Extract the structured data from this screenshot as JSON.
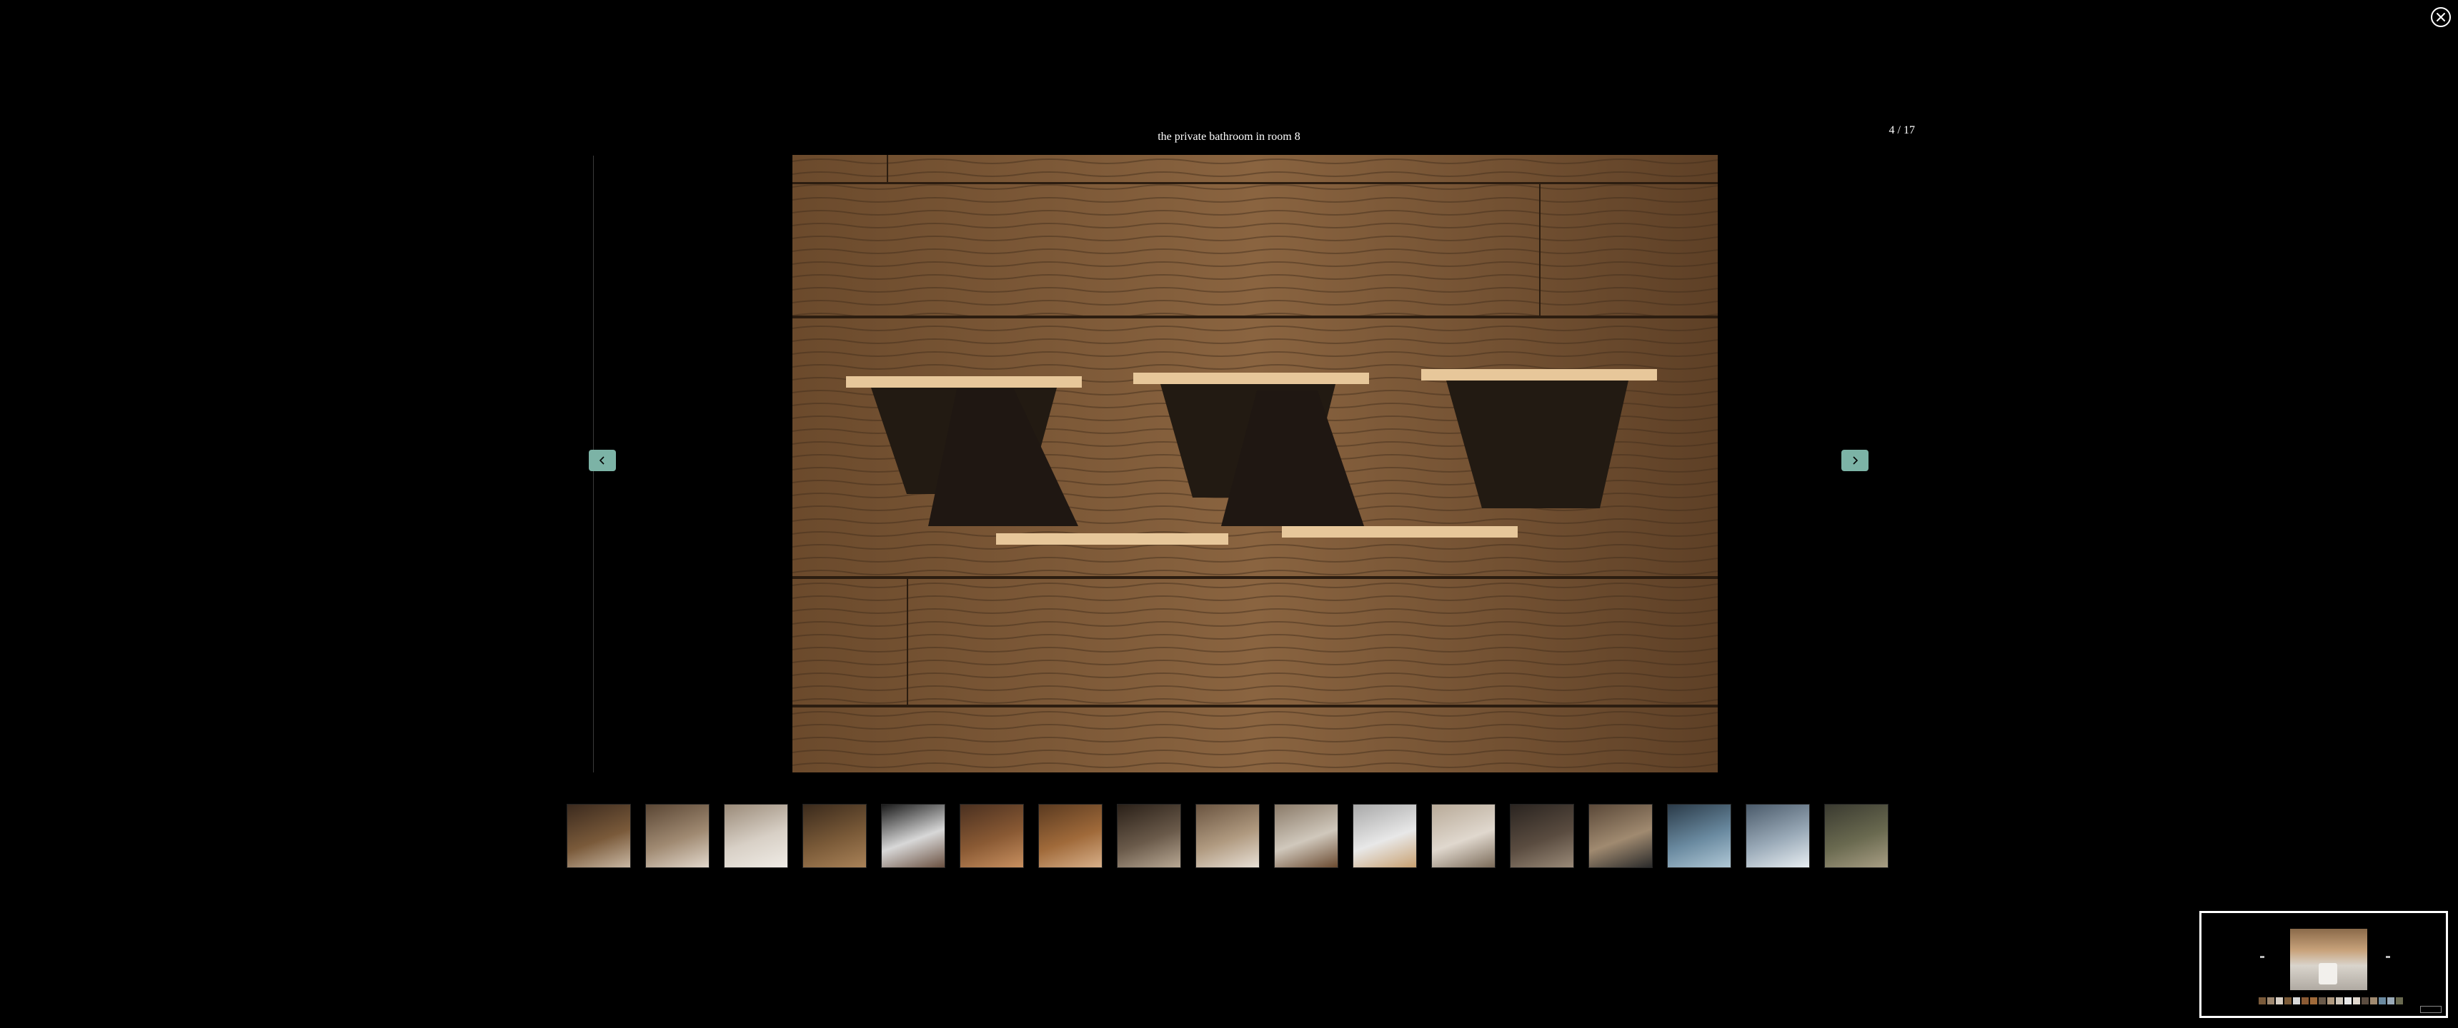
{
  "viewer": {
    "caption": "the private bathroom in room 8",
    "counter": "4 / 17",
    "current_index": 4,
    "total": 17
  },
  "icons": {
    "close": "close-icon",
    "prev": "chevron-left-icon",
    "next": "chevron-right-icon"
  },
  "colors": {
    "background": "#000000",
    "nav_button": "#7cb3a6",
    "text": "#ffffff"
  },
  "thumbnails": [
    {
      "palette": [
        "#3b2a1e",
        "#7a5a3a",
        "#c9b8a4"
      ]
    },
    {
      "palette": [
        "#5a4634",
        "#a08a72",
        "#e2d8cc"
      ]
    },
    {
      "palette": [
        "#9a8a78",
        "#d8d0c6",
        "#f0ece6"
      ]
    },
    {
      "palette": [
        "#3a2a1c",
        "#7a5a38",
        "#a98258"
      ]
    },
    {
      "palette": [
        "#1a1a1a",
        "#d8d8d8",
        "#6a5040"
      ]
    },
    {
      "palette": [
        "#4a3020",
        "#8a5a34",
        "#c89060"
      ]
    },
    {
      "palette": [
        "#5a3a20",
        "#a06a3a",
        "#d8b08a"
      ]
    },
    {
      "palette": [
        "#2a2018",
        "#6a5a4a",
        "#b8a894"
      ]
    },
    {
      "palette": [
        "#6a5440",
        "#b09a80",
        "#e8e0d6"
      ]
    },
    {
      "palette": [
        "#8a7a68",
        "#d0c8bc",
        "#6a4a30"
      ]
    },
    {
      "palette": [
        "#a8a8a8",
        "#e8e8e8",
        "#c8a070"
      ]
    },
    {
      "palette": [
        "#b8aa98",
        "#e0d8ce",
        "#7a6a58"
      ]
    },
    {
      "palette": [
        "#2a2420",
        "#5a4c40",
        "#9a8a78"
      ]
    },
    {
      "palette": [
        "#5a4838",
        "#a08a70",
        "#2a2a2a"
      ]
    },
    {
      "palette": [
        "#2a3a48",
        "#6a8aa0",
        "#b0c8d6"
      ]
    },
    {
      "palette": [
        "#4a5a6a",
        "#9aaab8",
        "#e8eef2"
      ]
    },
    {
      "palette": [
        "#3a3a30",
        "#6a6a50",
        "#a89e84"
      ]
    }
  ]
}
